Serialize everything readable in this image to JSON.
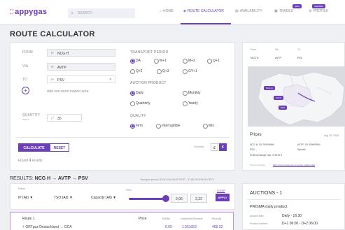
{
  "header": {
    "logo_text": "appygas",
    "search_placeholder": "SEARCH",
    "nav": [
      {
        "label": "HOME",
        "icon": "home-icon"
      },
      {
        "label": "ROUTE CALCULATOR",
        "icon": "route-icon",
        "active": true
      },
      {
        "label": "AVAILABILITY",
        "icon": "availability-icon"
      },
      {
        "label": "TRADES",
        "icon": "trades-icon",
        "badge": "NEW"
      },
      {
        "label": "PROFILE",
        "icon": "profile-icon",
        "badge": "MEMBER"
      }
    ]
  },
  "page_title": "ROUTE CALCULATOR",
  "form": {
    "from_label": "FROM",
    "from_value": "NCG H",
    "via_label": "VIA",
    "via_value": "AVTP",
    "to_label": "TO",
    "to_value": "PSV",
    "add_market_text": "Add one more market area",
    "quantity_label": "QUANTITY",
    "quantity_sub": "MWh/h",
    "quantity_value": "30",
    "calculate_label": "CALCULATE",
    "reset_label": "RESET",
    "found_text": "Found",
    "found_count": "4",
    "found_suffix": "results",
    "currency_label": "Currency",
    "currency_option_1": "£",
    "currency_option_2": "€"
  },
  "transport_period": {
    "title": "TRANSPORT PERIOD",
    "options": [
      "DA",
      "M+1",
      "M+2",
      "Q+1",
      "Q+2",
      "Q+3",
      "GY+1"
    ],
    "selected": "DA"
  },
  "auction_product": {
    "title": "AUCTION PRODUCT",
    "options": [
      "Daily",
      "Monthly",
      "Quarterly",
      "Yearly"
    ],
    "selected": "Daily"
  },
  "quality": {
    "title": "QUALITY",
    "options": [
      "Firm",
      "Interruptible",
      "Mix"
    ],
    "selected": "Firm"
  },
  "right_panel": {
    "col_from": "From",
    "col_via": "Via",
    "col_to": "To",
    "val_from": "NCG H",
    "val_via": "AVTP",
    "val_to": "PSV",
    "map_label_1": "NCG H",
    "map_label_2": "AVTP",
    "map_label_3": "PSV",
    "prices_title": "Prices",
    "prices_date": "Aug 29, 2018",
    "price_ncg": "NCG H: 25.752€/MWh",
    "price_avtp": "AVTP: 23.039€/MWh",
    "price_psv": "PSV: -",
    "spread_label": "Spread:",
    "ece_rate": "ECB exchange rate: 0.9076 €",
    "source_label": "Source of prices:",
    "source_value": "https://www.powernext.com/spot-market-data"
  },
  "results": {
    "prefix": "RESULTS:",
    "route": "NCG H → AVTP → PSV",
    "period_label": "Transport period:",
    "period_value": "30.08.2018 06:00 CEST - 31.08.2018 06:00 CEST",
    "filters_label": "Filters",
    "filter_ip": "IP (All)",
    "filter_tso": "TSO (All)",
    "filter_capacity": "Capacity (All)",
    "price_label": "Price",
    "price_min": "2,06",
    "price_max": "2,22",
    "clear_label": "CLEAR",
    "apply_label": "APPLY",
    "price_fill_fraction": 0.92
  },
  "route_card": {
    "title": "Route 1",
    "col_price": "Price",
    "col_kwh": "€/MWh",
    "col_runtime": "cent/kWh/h/Runtime",
    "col_price_e": "Price (€)",
    "row_label": "GRTgaz Deutschland → GCA",
    "row_val_1": "0.65",
    "row_val_2": "1.561053",
    "row_val_3": "468.32"
  },
  "auctions": {
    "title": "AUCTIONS - 1",
    "product_title": "PRISMA daily product",
    "start_label": "Auction start:",
    "start_value": "Daily - 16:30",
    "runtime_label": "Product runtime:",
    "runtime_value": "D+1 06:00 - D+2 06:00"
  }
}
